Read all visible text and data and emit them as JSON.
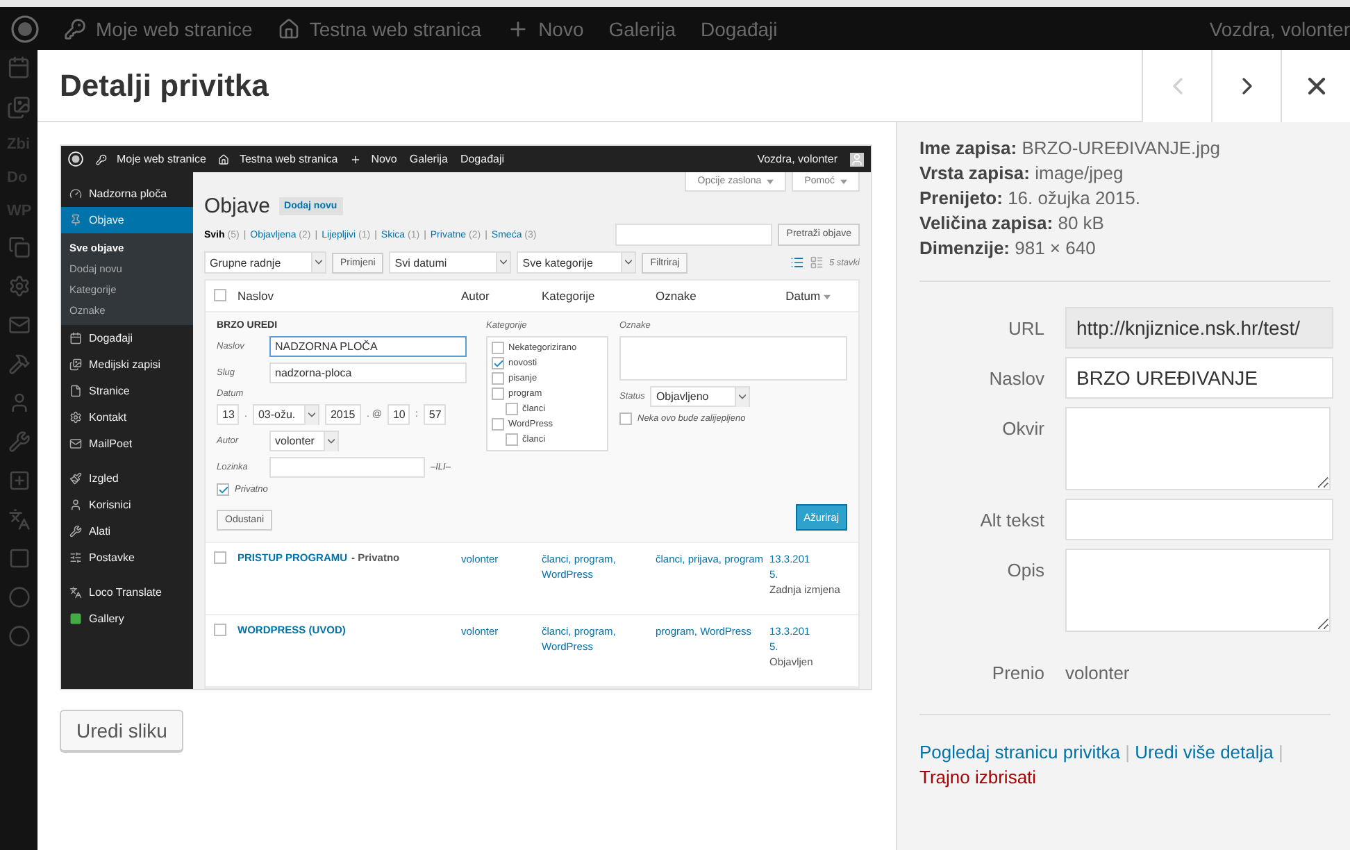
{
  "admin_bar": {
    "items": [
      "Moje web stranice",
      "Testna web stranica",
      "Novo",
      "Galerija",
      "Događaji"
    ],
    "greeting": "Vozdra, volonter"
  },
  "background_menu": [
    "Zbi",
    "Do",
    "WP"
  ],
  "modal": {
    "title": "Detalji privitka",
    "nav": [
      {
        "kind": "prev",
        "disabled": true
      },
      {
        "kind": "next",
        "disabled": false
      },
      {
        "kind": "close",
        "disabled": false
      }
    ]
  },
  "preview": {
    "admin_bar": {
      "items": [
        "Moje web stranice",
        "Testna web stranica",
        "Novo",
        "Galerija",
        "Događaji"
      ],
      "greeting": "Vozdra, volonter"
    },
    "menu": [
      [
        {
          "label": "Nadzorna ploča",
          "selected": false
        },
        {
          "label": "Objave",
          "selected": true,
          "children": [
            {
              "label": "Sve objave",
              "selected": true
            },
            {
              "label": "Dodaj novu",
              "selected": false
            },
            {
              "label": "Kategorije",
              "selected": false
            },
            {
              "label": "Oznake",
              "selected": false
            }
          ]
        },
        {
          "label": "Događaji",
          "selected": false
        },
        {
          "label": "Medijski zapisi",
          "selected": false
        },
        {
          "label": "Stranice",
          "selected": false
        },
        {
          "label": "Kontakt",
          "selected": false
        },
        {
          "label": "MailPoet",
          "selected": false
        }
      ],
      [
        {
          "label": "Izgled",
          "selected": false
        },
        {
          "label": "Korisnici",
          "selected": false
        },
        {
          "label": "Alati",
          "selected": false
        },
        {
          "label": "Postavke",
          "selected": false
        }
      ],
      [
        {
          "label": "Loco Translate",
          "selected": false
        },
        {
          "label": "Gallery",
          "selected": false
        }
      ]
    ],
    "screen_tabs": [
      "Opcije zaslona",
      "Pomoć"
    ],
    "heading": "Objave",
    "add_new": "Dodaj novu",
    "filters": [
      {
        "label": "Svih",
        "count": "(5)",
        "selected": true
      },
      {
        "label": "Objavljena",
        "count": "(2)",
        "selected": false
      },
      {
        "label": "Lijepljivi",
        "count": "(1)",
        "selected": false
      },
      {
        "label": "Skica",
        "count": "(1)",
        "selected": false
      },
      {
        "label": "Privatne",
        "count": "(2)",
        "selected": false
      },
      {
        "label": "Smeća",
        "count": "(3)",
        "selected": false
      }
    ],
    "filter_separators": [
      "|",
      "|",
      "|",
      "|",
      "|"
    ],
    "search_button": "Pretraži objave",
    "bulk_action": "Grupne radnje",
    "apply": "Primjeni",
    "dates": "Svi datumi",
    "categories": "Sve kategorije",
    "filter": "Filtriraj",
    "item_count": "5 stavki",
    "columns": [
      "Naslov",
      "Autor",
      "Kategorije",
      "Oznake",
      "Datum"
    ],
    "select_all_checked": false,
    "quick_edit": {
      "title": "BRZO UREDI",
      "title_label": "Naslov",
      "title_value": "NADZORNA PLOČA",
      "slug_label": "Slug",
      "slug_value": "nadzorna-ploca",
      "date_label": "Datum",
      "date_parts": [
        {
          "kind": "field",
          "text": "13"
        },
        {
          "kind": "sep",
          "text": "."
        },
        {
          "kind": "select",
          "text": "03-ožu."
        },
        {
          "kind": "field",
          "text": "2015"
        },
        {
          "kind": "sep",
          "text": ". @"
        },
        {
          "kind": "field",
          "text": "10"
        },
        {
          "kind": "sep",
          "text": ":"
        },
        {
          "kind": "field",
          "text": "57"
        }
      ],
      "author_label": "Autor",
      "author_value": "volonter",
      "password_label": "Lozinka",
      "or_text": "–ILI–",
      "private": {
        "label": "Privatno",
        "checked": true
      },
      "categories_label": "Kategorije",
      "category_list": [
        {
          "label": "Nekategorizirano",
          "checked": false
        },
        {
          "label": "novosti",
          "checked": true
        },
        {
          "label": "pisanje",
          "checked": false
        },
        {
          "label": "program",
          "checked": false,
          "children": [
            {
              "label": "članci",
              "checked": false
            }
          ]
        },
        {
          "label": "WordPress",
          "checked": false,
          "children": [
            {
              "label": "članci",
              "checked": false
            }
          ]
        }
      ],
      "tags_label": "Oznake",
      "status_label": "Status",
      "status_value": "Objavljeno",
      "sticky": {
        "label": "Neka ovo bude zalijepljeno",
        "checked": false
      },
      "cancel": "Odustani",
      "update": "Ažuriraj"
    },
    "rows": [
      {
        "checked": false,
        "title": "PRISTUP PROGRAMU",
        "state": "- Privatno",
        "author": "volonter",
        "categories": "članci, program, WordPress",
        "tags": "članci, prijava, program",
        "date": "13.3.2015.",
        "date_status": "Zadnja izmjena"
      },
      {
        "checked": false,
        "title": "WORDPRESS (UVOD)",
        "author": "volonter",
        "categories": "članci, program, WordPress",
        "tags": "program, WordPress",
        "date": "13.3.2015.",
        "date_status": "Objavljen"
      }
    ]
  },
  "edit_image_button": "Uredi sliku",
  "details": [
    "**Ime zapisa:** BRZO-UREĐIVANJE.jpg",
    "**Vrsta zapisa:** image/jpeg",
    "**Prenijeto:** 16. ožujka 2015.",
    "**Veličina zapisa:** 80 kB",
    "**Dimenzije:** 981 × 640"
  ],
  "fields": [
    {
      "kind": "readonly",
      "label": "URL",
      "value": "http://knjiznice.nsk.hr/test/"
    },
    {
      "kind": "input",
      "label": "Naslov",
      "value": "BRZO UREĐIVANJE"
    },
    {
      "kind": "textarea",
      "label": "Okvir"
    },
    {
      "kind": "input",
      "label": "Alt tekst"
    },
    {
      "kind": "textarea",
      "label": "Opis"
    },
    {
      "kind": "text",
      "label": "Prenio",
      "value": "volonter"
    }
  ],
  "links": [
    {
      "text": "Pogledaj stranicu privitka",
      "kind": "normal"
    },
    {
      "text": "Uredi više detalja",
      "kind": "normal"
    },
    {
      "text": "Trajno izbrisati",
      "kind": "danger"
    }
  ],
  "link_separators": [
    "|",
    "|"
  ]
}
